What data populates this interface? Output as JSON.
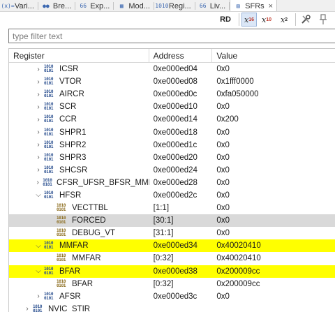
{
  "tabs": [
    {
      "label": "Vari...",
      "icon": "x-equals-icon",
      "glyph": "(x)="
    },
    {
      "label": "Bre...",
      "icon": "breakpoints-icon",
      "glyph": "●●"
    },
    {
      "label": "Exp...",
      "icon": "expressions-icon",
      "glyph": "66"
    },
    {
      "label": "Mod...",
      "icon": "modules-icon",
      "glyph": "▦"
    },
    {
      "label": "Regi...",
      "icon": "registers-icon",
      "glyph": "1010"
    },
    {
      "label": "Liv...",
      "icon": "live-expressions-icon",
      "glyph": "66"
    },
    {
      "label": "SFRs",
      "icon": "sfrs-icon",
      "glyph": "▤",
      "active": true
    }
  ],
  "toolbar": {
    "rd_label": "RD",
    "hex_base": "16",
    "dec_base": "10",
    "bin_base": "2",
    "x_label": "x"
  },
  "filter": {
    "placeholder": "type filter text"
  },
  "columns": {
    "register": "Register",
    "address": "Address",
    "value": "Value"
  },
  "rows": [
    {
      "name": "ICSR",
      "address": "0xe000ed04",
      "value": "0x0",
      "level": 0,
      "expander": "collapsed"
    },
    {
      "name": "VTOR",
      "address": "0xe000ed08",
      "value": "0x1fff0000",
      "level": 0,
      "expander": "collapsed"
    },
    {
      "name": "AIRCR",
      "address": "0xe000ed0c",
      "value": "0xfa050000",
      "level": 0,
      "expander": "collapsed"
    },
    {
      "name": "SCR",
      "address": "0xe000ed10",
      "value": "0x0",
      "level": 0,
      "expander": "collapsed"
    },
    {
      "name": "CCR",
      "address": "0xe000ed14",
      "value": "0x200",
      "level": 0,
      "expander": "collapsed"
    },
    {
      "name": "SHPR1",
      "address": "0xe000ed18",
      "value": "0x0",
      "level": 0,
      "expander": "collapsed"
    },
    {
      "name": "SHPR2",
      "address": "0xe000ed1c",
      "value": "0x0",
      "level": 0,
      "expander": "collapsed"
    },
    {
      "name": "SHPR3",
      "address": "0xe000ed20",
      "value": "0x0",
      "level": 0,
      "expander": "collapsed"
    },
    {
      "name": "SHCSR",
      "address": "0xe000ed24",
      "value": "0x0",
      "level": 0,
      "expander": "collapsed"
    },
    {
      "name": "CFSR_UFSR_BFSR_MMFSR",
      "address": "0xe000ed28",
      "value": "0x0",
      "level": 0,
      "expander": "collapsed"
    },
    {
      "name": "HFSR",
      "address": "0xe000ed2c",
      "value": "0x0",
      "level": 0,
      "expander": "expanded"
    },
    {
      "name": "VECTTBL",
      "address": "[1:1]",
      "value": "0x0",
      "level": 1,
      "expander": "none"
    },
    {
      "name": "FORCED",
      "address": "[30:1]",
      "value": "0x0",
      "level": 1,
      "expander": "none",
      "state": "selected"
    },
    {
      "name": "DEBUG_VT",
      "address": "[31:1]",
      "value": "0x0",
      "level": 1,
      "expander": "none"
    },
    {
      "name": "MMFAR",
      "address": "0xe000ed34",
      "value": "0x40020410",
      "level": 0,
      "expander": "expanded",
      "state": "highlighted"
    },
    {
      "name": "MMFAR",
      "address": "[0:32]",
      "value": "0x40020410",
      "level": 1,
      "expander": "none"
    },
    {
      "name": "BFAR",
      "address": "0xe000ed38",
      "value": "0x200009cc",
      "level": 0,
      "expander": "expanded",
      "state": "highlighted"
    },
    {
      "name": "BFAR",
      "address": "[0:32]",
      "value": "0x200009cc",
      "level": 1,
      "expander": "none"
    },
    {
      "name": "AFSR",
      "address": "0xe000ed3c",
      "value": "0x0",
      "level": 0,
      "expander": "collapsed"
    },
    {
      "name": "NVIC_STIR",
      "address": "",
      "value": "",
      "level": -1,
      "expander": "collapsed"
    }
  ],
  "colors": {
    "highlight": "#ffff00",
    "selected": "#d9d9d9"
  }
}
